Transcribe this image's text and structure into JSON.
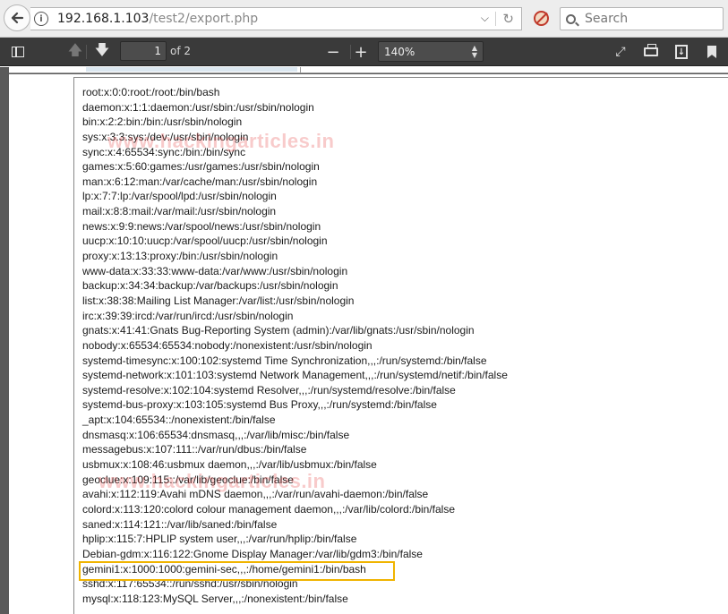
{
  "browser": {
    "url_host": "192.168.1.103",
    "url_path": "/test2/export.php",
    "search_placeholder": "Search"
  },
  "pdf_toolbar": {
    "current_page": "1",
    "page_count": "of 2",
    "zoom": "140%"
  },
  "watermark": "www.hackingarticles.in",
  "document": {
    "lines": [
      "root:x:0:0:root:/root:/bin/bash",
      "daemon:x:1:1:daemon:/usr/sbin:/usr/sbin/nologin",
      "bin:x:2:2:bin:/bin:/usr/sbin/nologin",
      "sys:x:3:3:sys:/dev:/usr/sbin/nologin",
      "sync:x:4:65534:sync:/bin:/bin/sync",
      "games:x:5:60:games:/usr/games:/usr/sbin/nologin",
      "man:x:6:12:man:/var/cache/man:/usr/sbin/nologin",
      "lp:x:7:7:lp:/var/spool/lpd:/usr/sbin/nologin",
      "mail:x:8:8:mail:/var/mail:/usr/sbin/nologin",
      "news:x:9:9:news:/var/spool/news:/usr/sbin/nologin",
      "uucp:x:10:10:uucp:/var/spool/uucp:/usr/sbin/nologin",
      "proxy:x:13:13:proxy:/bin:/usr/sbin/nologin",
      "www-data:x:33:33:www-data:/var/www:/usr/sbin/nologin",
      "backup:x:34:34:backup:/var/backups:/usr/sbin/nologin",
      "list:x:38:38:Mailing List Manager:/var/list:/usr/sbin/nologin",
      "irc:x:39:39:ircd:/var/run/ircd:/usr/sbin/nologin",
      "gnats:x:41:41:Gnats Bug-Reporting System (admin):/var/lib/gnats:/usr/sbin/nologin",
      "nobody:x:65534:65534:nobody:/nonexistent:/usr/sbin/nologin",
      "systemd-timesync:x:100:102:systemd Time Synchronization,,,:/run/systemd:/bin/false",
      "systemd-network:x:101:103:systemd Network Management,,,:/run/systemd/netif:/bin/false",
      "systemd-resolve:x:102:104:systemd Resolver,,,:/run/systemd/resolve:/bin/false",
      "systemd-bus-proxy:x:103:105:systemd Bus Proxy,,,:/run/systemd:/bin/false",
      "_apt:x:104:65534::/nonexistent:/bin/false",
      "dnsmasq:x:106:65534:dnsmasq,,,:/var/lib/misc:/bin/false",
      "messagebus:x:107:111::/var/run/dbus:/bin/false",
      "usbmux:x:108:46:usbmux daemon,,,:/var/lib/usbmux:/bin/false",
      "geoclue:x:109:115::/var/lib/geoclue:/bin/false",
      "avahi:x:112:119:Avahi mDNS daemon,,,:/var/run/avahi-daemon:/bin/false",
      "colord:x:113:120:colord colour management daemon,,,:/var/lib/colord:/bin/false",
      "saned:x:114:121::/var/lib/saned:/bin/false",
      "hplip:x:115:7:HPLIP system user,,,:/var/run/hplip:/bin/false",
      "Debian-gdm:x:116:122:Gnome Display Manager:/var/lib/gdm3:/bin/false",
      "gemini1:x:1000:1000:gemini-sec,,,:/home/gemini1:/bin/bash",
      "sshd:x:117:65534::/run/sshd:/usr/sbin/nologin",
      "mysql:x:118:123:MySQL Server,,,:/nonexistent:/bin/false"
    ]
  },
  "colors": {
    "highlight": "#f0b400",
    "toolbar_bg": "#3a3a3a",
    "watermark": "#e64646"
  }
}
